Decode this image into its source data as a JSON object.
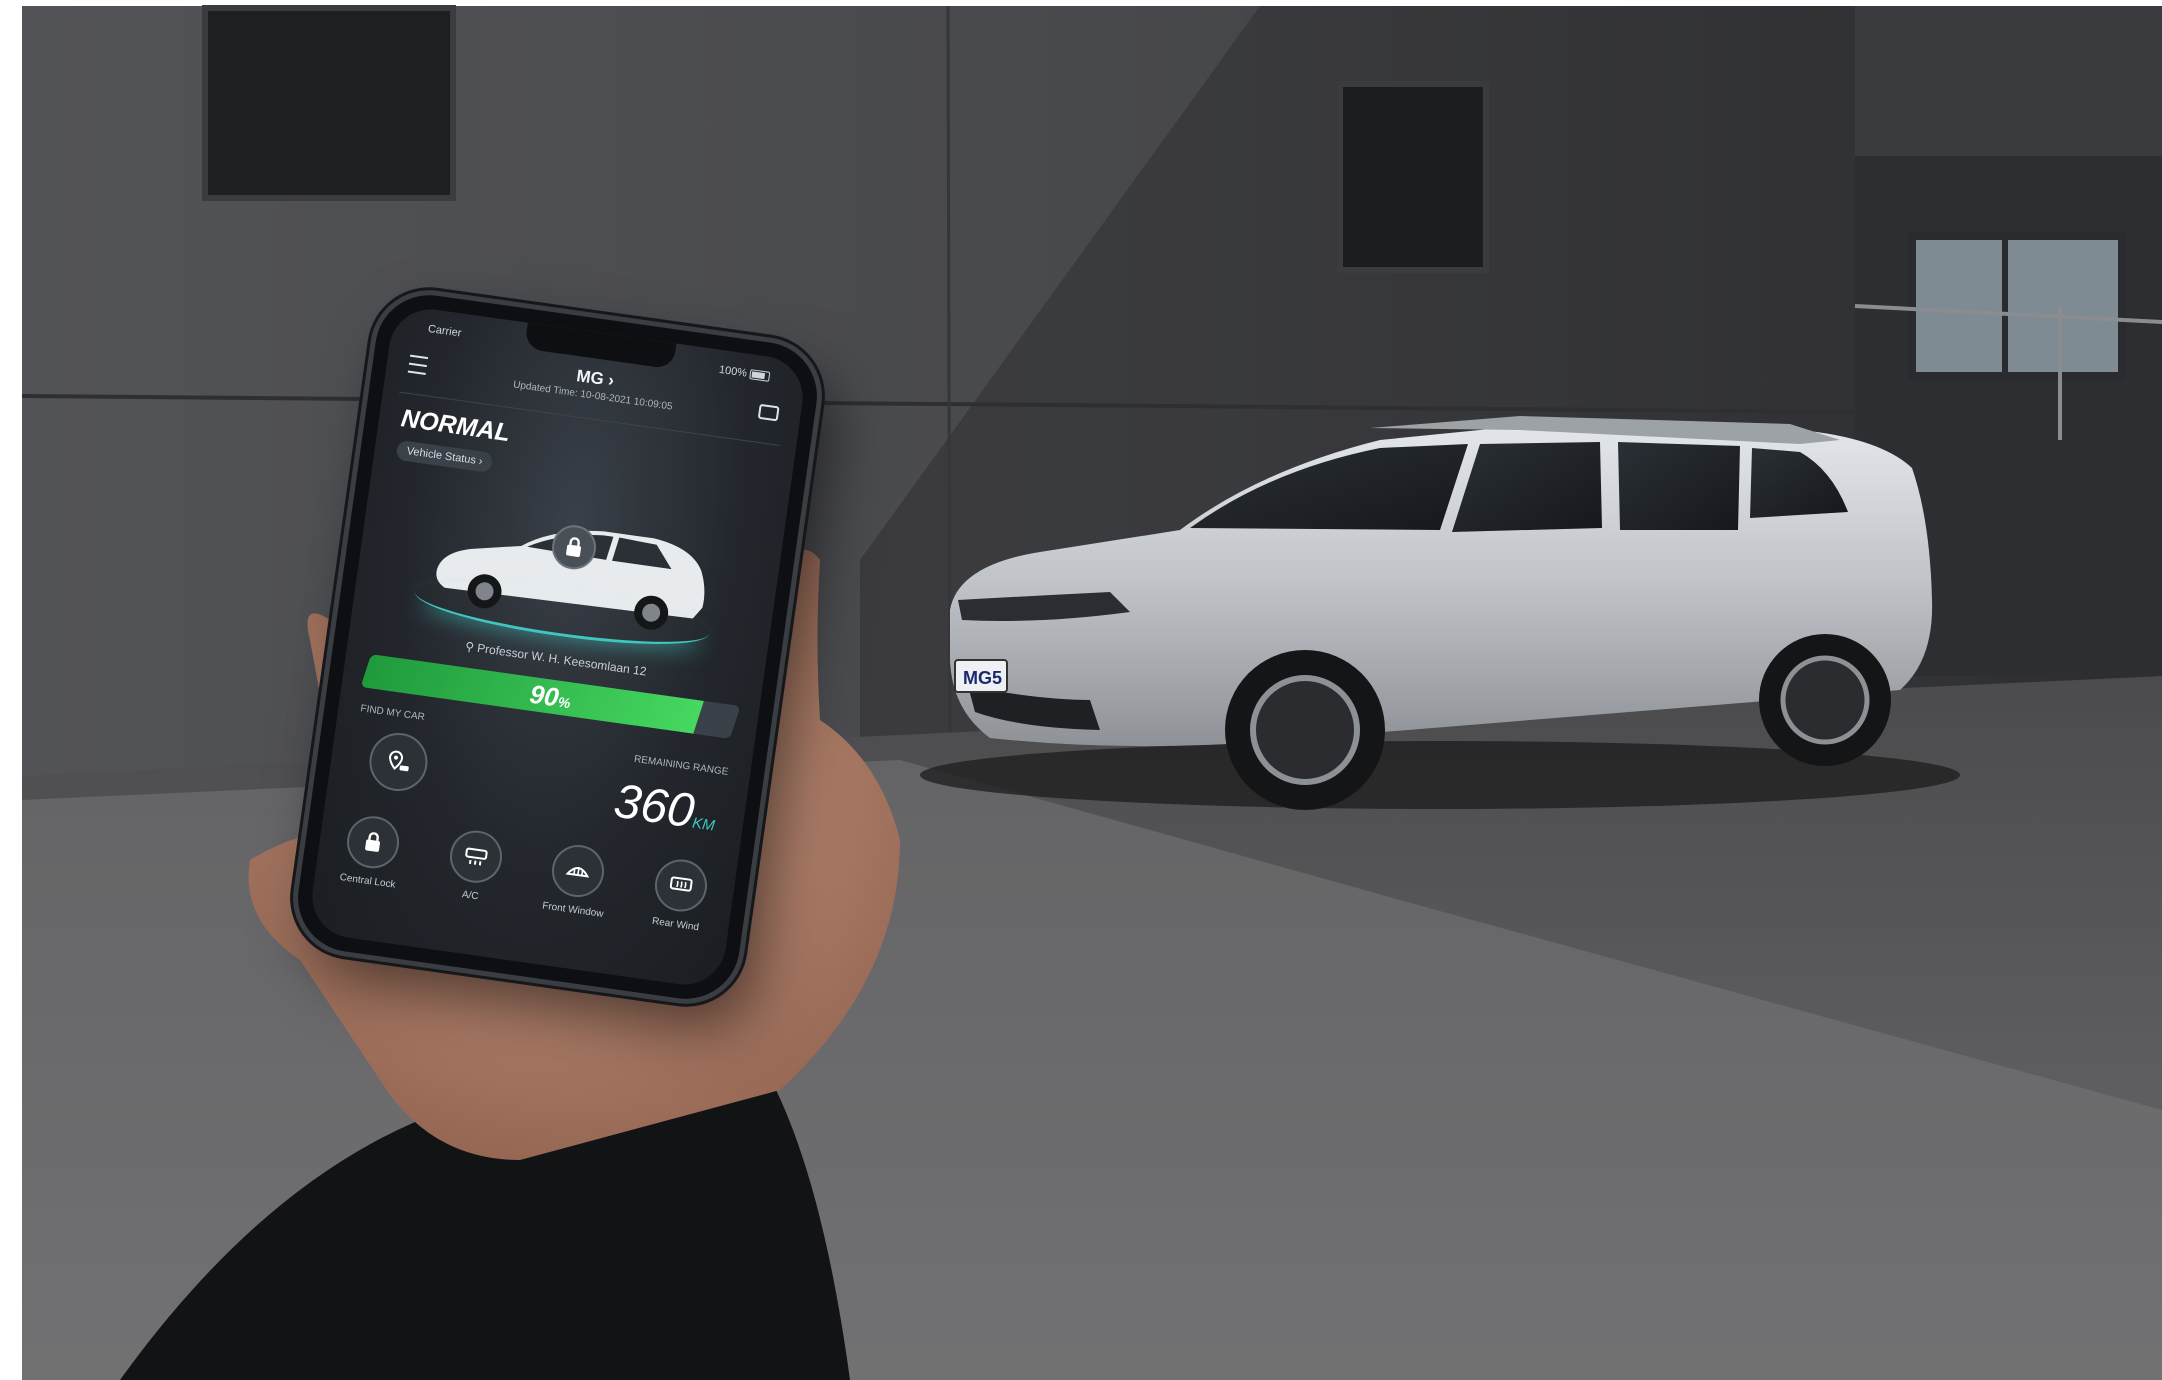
{
  "phone": {
    "status_left": "Carrier",
    "status_right": "100%",
    "header": {
      "title": "MG ›",
      "subtitle": "Updated Time: 10-08-2021 10:09:05"
    },
    "mode": "NORMAL",
    "vehicle_status_label": "Vehicle Status ›",
    "address": "Professor W. H. Keesomlaan 12",
    "battery": {
      "percent": 90,
      "percent_unit": "%"
    },
    "find_my_car_label": "FIND MY CAR",
    "remaining_range_label": "REMAINING RANGE",
    "range": {
      "value": "360",
      "unit": "KM"
    },
    "controls": [
      {
        "label": "Central Lock",
        "icon": "lock-icon"
      },
      {
        "label": "A/C",
        "icon": "ac-icon"
      },
      {
        "label": "Front Window",
        "icon": "front-defrost-icon"
      },
      {
        "label": "Rear Wind",
        "icon": "rear-defrost-icon"
      }
    ]
  },
  "car": {
    "plate": "MG5"
  },
  "colors": {
    "accent": "#3fc6c0",
    "battery_fill": "#46d860",
    "car_body": "#c9cdd1",
    "wall": "#4a4b4e"
  }
}
